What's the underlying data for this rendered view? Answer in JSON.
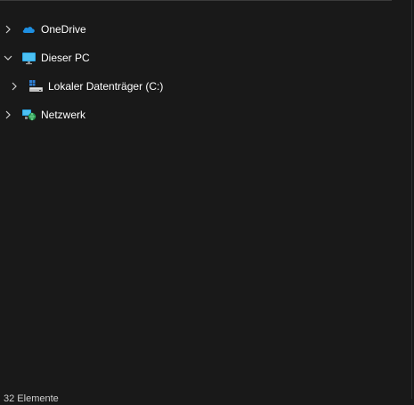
{
  "nav_tree": {
    "items": [
      {
        "label": "OneDrive",
        "icon": "onedrive-cloud-icon",
        "expanded": false
      },
      {
        "label": "Dieser PC",
        "icon": "monitor-icon",
        "expanded": true
      },
      {
        "label": "Lokaler Datenträger (C:)",
        "icon": "drive-icon",
        "expanded": false
      },
      {
        "label": "Netzwerk",
        "icon": "network-icon",
        "expanded": false
      }
    ]
  },
  "status_bar": {
    "text": "32 Elemente"
  },
  "colors": {
    "background": "#191919",
    "text": "#ffffff",
    "chevron": "#cfcfcf",
    "onedrive_blue": "#1e8fe1",
    "monitor_blue": "#2aa5e6"
  }
}
